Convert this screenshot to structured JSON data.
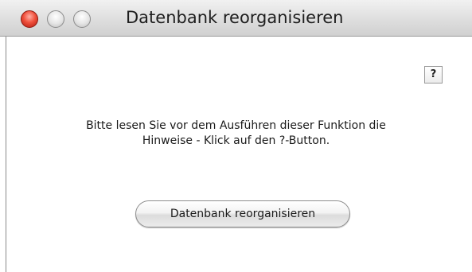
{
  "window": {
    "title": "Datenbank reorganisieren",
    "controls": {
      "close": "close-button",
      "minimize": "minimize-button",
      "zoom": "zoom-button"
    }
  },
  "help_button": {
    "label": "?"
  },
  "message": {
    "line1": "Bitte lesen Sie vor dem Ausführen dieser Funktion die",
    "line2": "Hinweise - Klick auf den ?-Button."
  },
  "primary_button": {
    "label": "Datenbank reorganisieren"
  },
  "colors": {
    "close_red": "#f0503c",
    "window_bg": "#ffffff",
    "titlebar": "#dedede"
  }
}
